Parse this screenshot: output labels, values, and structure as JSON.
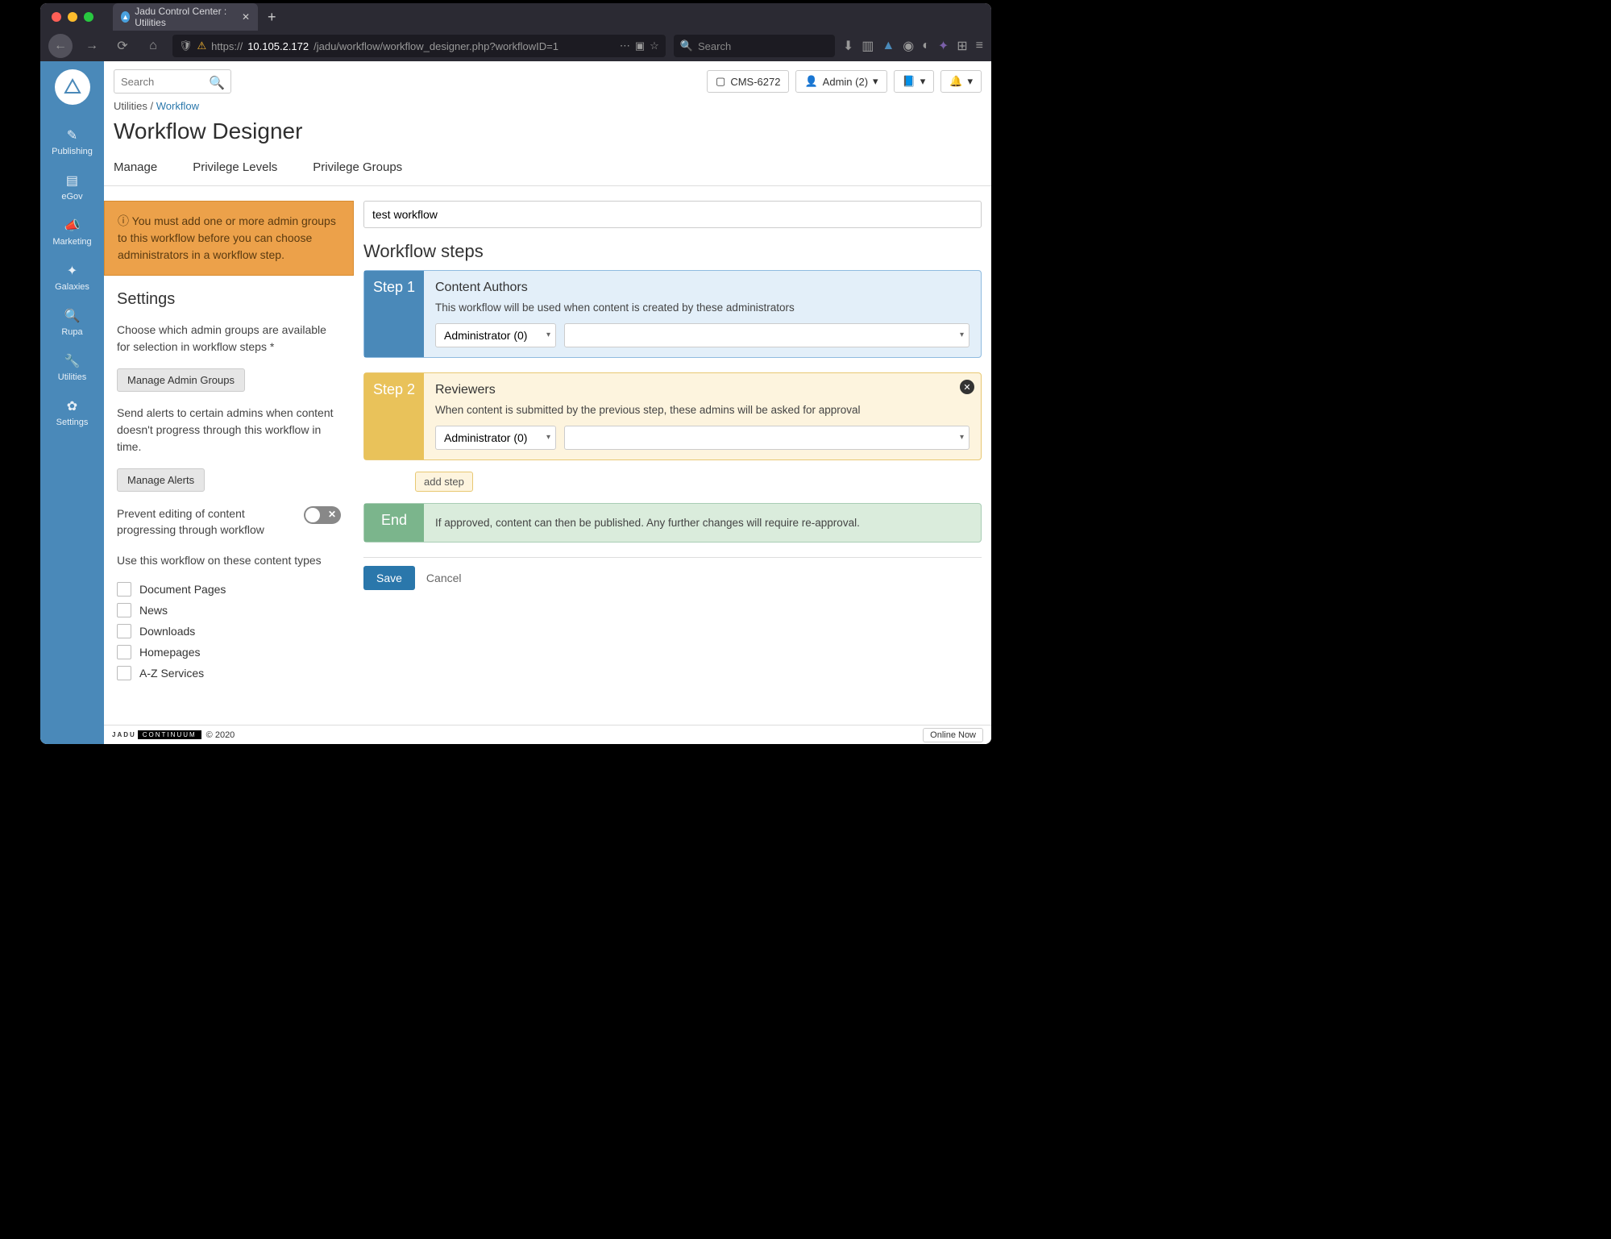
{
  "browser": {
    "tab_title": "Jadu Control Center : Utilities",
    "url_prefix": "https://",
    "url_host": "10.105.2.172",
    "url_path": "/jadu/workflow/workflow_designer.php?workflowID=1",
    "search_placeholder": "Search"
  },
  "sidebar": {
    "items": [
      {
        "label": "Publishing",
        "icon": "✎"
      },
      {
        "label": "eGov",
        "icon": "▤"
      },
      {
        "label": "Marketing",
        "icon": "◀"
      },
      {
        "label": "Galaxies",
        "icon": "⚙"
      },
      {
        "label": "Rupa",
        "icon": "🔍"
      },
      {
        "label": "Utilities",
        "icon": "🔧"
      },
      {
        "label": "Settings",
        "icon": "✿"
      }
    ]
  },
  "header": {
    "search_placeholder": "Search",
    "cms_badge": "CMS-6272",
    "admin_label": "Admin (2)"
  },
  "breadcrumb": {
    "root": "Utilities",
    "sep": " / ",
    "leaf": "Workflow"
  },
  "page_title": "Workflow Designer",
  "tabs": [
    {
      "label": "Manage"
    },
    {
      "label": "Privilege Levels"
    },
    {
      "label": "Privilege Groups"
    }
  ],
  "alert": "You must add one or more admin groups to this workflow before you can choose administrators in a workflow step.",
  "settings": {
    "heading": "Settings",
    "groups_help": "Choose which admin groups are available for selection in workflow steps *",
    "manage_groups_btn": "Manage Admin Groups",
    "alerts_help": "Send alerts to certain admins when content doesn't progress through this workflow in time.",
    "manage_alerts_btn": "Manage Alerts",
    "prevent_label": "Prevent editing of content progressing through workflow",
    "content_types_label": "Use this workflow on these content types",
    "content_types": [
      "Document Pages",
      "News",
      "Downloads",
      "Homepages",
      "A-Z Services"
    ]
  },
  "workflow": {
    "name_value": "test workflow",
    "steps_heading": "Workflow steps",
    "step1": {
      "label": "Step 1",
      "title": "Content Authors",
      "desc": "This workflow will be used when content is created by these administrators",
      "select_value": "Administrator (0)"
    },
    "step2": {
      "label": "Step 2",
      "title": "Reviewers",
      "desc": "When content is submitted by the previous step, these admins will be asked for approval",
      "select_value": "Administrator (0)"
    },
    "add_step": "add step",
    "end": {
      "label": "End",
      "desc": "If approved, content can then be published. Any further changes will require re-approval."
    }
  },
  "actions": {
    "save": "Save",
    "cancel": "Cancel"
  },
  "footer": {
    "brand": "JADU",
    "product": "CONTINUUM",
    "copyright": "© 2020",
    "online": "Online Now"
  }
}
